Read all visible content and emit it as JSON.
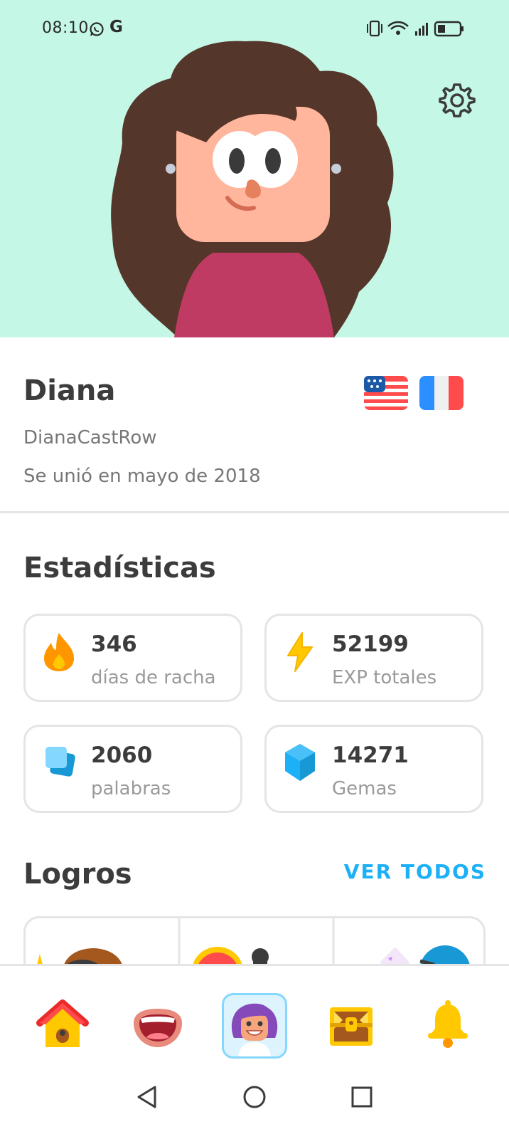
{
  "status_bar": {
    "time": "08:10",
    "icons": [
      "whatsapp-icon",
      "google-icon",
      "vibrate-icon",
      "wifi-icon",
      "signal-icon",
      "battery-icon"
    ]
  },
  "header": {
    "settings_icon": "gear-icon",
    "background": "#c4f7e6"
  },
  "profile": {
    "name": "Diana",
    "username": "DianaCastRow",
    "joined": "Se unió en mayo de 2018",
    "flags": [
      "us-flag-icon",
      "france-flag-icon"
    ]
  },
  "stats": {
    "title": "Estadísticas",
    "items": [
      {
        "value": "346",
        "label": "días de racha",
        "icon": "flame-icon"
      },
      {
        "value": "52199",
        "label": "EXP totales",
        "icon": "lightning-icon"
      },
      {
        "value": "2060",
        "label": "palabras",
        "icon": "words-cards-icon"
      },
      {
        "value": "14271",
        "label": "Gemas",
        "icon": "gem-icon"
      }
    ]
  },
  "achievements": {
    "title": "Logros",
    "see_all": "VER TODOS"
  },
  "bottom_nav": {
    "items": [
      "home-icon",
      "speaking-mouth-icon",
      "profile-avatar-icon",
      "treasure-chest-icon",
      "bell-icon"
    ],
    "active": "profile-avatar-icon"
  },
  "colors": {
    "accent": "#1cb0f6",
    "text": "#3c3c3c",
    "muted": "#777777",
    "border": "#e5e5e5"
  }
}
